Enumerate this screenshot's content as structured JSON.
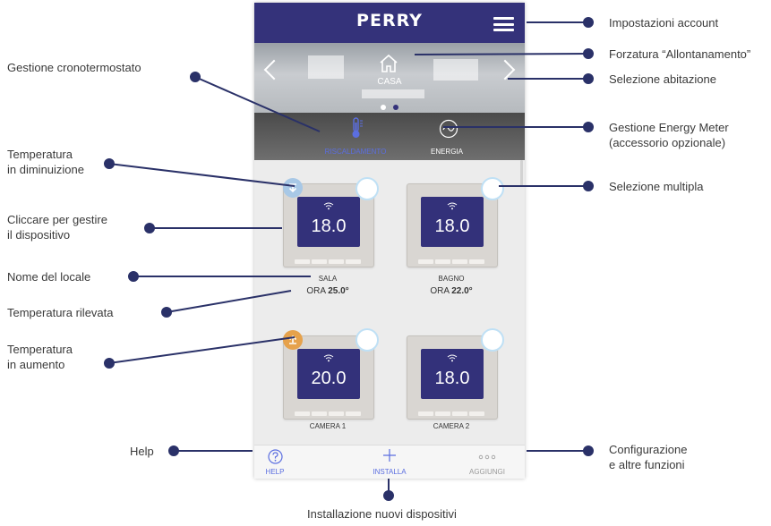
{
  "app": {
    "logo": "PERRY",
    "hero": {
      "location_label": "CASA"
    },
    "modes": {
      "heating_label": "RISCALDAMENTO",
      "energy_label": "ENERGIA"
    },
    "devices": [
      {
        "room": "SALA",
        "set_temp": "18.0",
        "detected_prefix": "ORA",
        "detected_temp": "25.0°",
        "trend": "down"
      },
      {
        "room": "BAGNO",
        "set_temp": "18.0",
        "detected_prefix": "ORA",
        "detected_temp": "22.0°",
        "trend": "none"
      },
      {
        "room": "CAMERA 1",
        "set_temp": "20.0",
        "trend": "up"
      },
      {
        "room": "CAMERA 2",
        "set_temp": "18.0",
        "trend": "none"
      }
    ],
    "bottom": {
      "help_label": "HELP",
      "install_label": "INSTALLA",
      "more_label": "AGGIUNGI"
    }
  },
  "annotations": {
    "left": {
      "crono": "Gestione cronotermostato",
      "temp_down": "Temperatura\nin diminuizione",
      "click_manage": "Cliccare per gestire\nil dispositivo",
      "room_name": "Nome del locale",
      "detected_temp": "Temperatura rilevata",
      "temp_up": "Temperatura\nin aumento",
      "help": "Help"
    },
    "right": {
      "account": "Impostazioni account",
      "away": "Forzatura “Allontanamento”",
      "home_select": "Selezione abitazione",
      "energy_meter": "Gestione Energy Meter\n(accessorio opzionale)",
      "multi_select": "Selezione multipla",
      "config": "Configurazione\ne altre funzioni"
    },
    "bottom": {
      "install": "Installazione nuovi dispositivi"
    }
  },
  "colors": {
    "brand": "#34327a",
    "accent_blue": "#5b6ee0",
    "selection_ring": "#bfe0f5",
    "trend_up": "#e6a24c",
    "trend_down": "#a8c8e6"
  }
}
